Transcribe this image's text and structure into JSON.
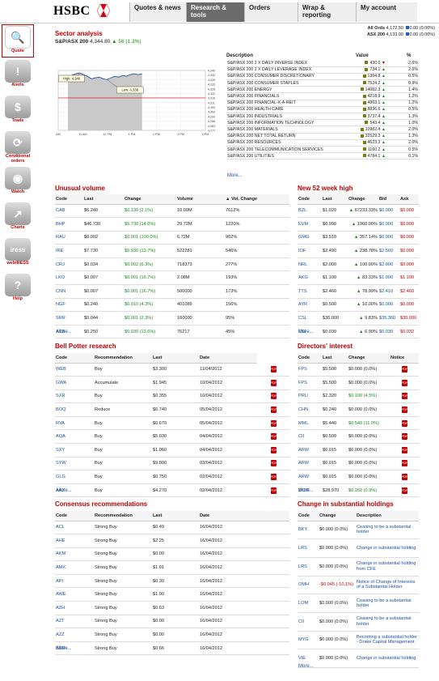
{
  "brand": {
    "logo_text": "HSBC"
  },
  "nav": [
    "Quotes & news",
    "Research & tools",
    "Orders",
    "Wrap & reporting",
    "My account"
  ],
  "indices": [
    {
      "name": "All Ords",
      "value": "4,172.50",
      "change": "0.00 (0.00%)"
    },
    {
      "name": "ASX 200",
      "value": "4,133.00",
      "change": "0.00 (0.00%)"
    }
  ],
  "sidebar": [
    {
      "label": "Quote",
      "icon": "magnifier-icon",
      "glyph": "🔍"
    },
    {
      "label": "Alerts",
      "icon": "warning-icon",
      "glyph": "!"
    },
    {
      "label": "Trade",
      "icon": "dollar-icon",
      "glyph": "$"
    },
    {
      "label": "Conditional orders",
      "icon": "refresh-icon",
      "glyph": "⟳"
    },
    {
      "label": "Watch",
      "icon": "binoculars-icon",
      "glyph": "◉"
    },
    {
      "label": "Charts",
      "icon": "chart-icon",
      "glyph": "↗"
    },
    {
      "label": "webIRESS",
      "icon": "iress-icon",
      "glyph": "iress"
    },
    {
      "label": "Help",
      "icon": "help-icon",
      "glyph": "?"
    }
  ],
  "sector": {
    "title": "Sector analysis",
    "index_name": "S&P/ASX 200",
    "index_value": "4,344.80",
    "index_change": "56 (1.3%)",
    "desc_header": "Description",
    "value_header": "Value",
    "pct_header": "%",
    "rows": [
      {
        "d": "S&P/ASX 200 2 X DAILY INVERSE INDEX",
        "v": "430.0",
        "p": "-2.6%",
        "dir": "down"
      },
      {
        "d": "S&P/ASX 200 2 X DAILY LEVERAGE INDEX",
        "v": "734.1",
        "p": "2.6%",
        "dir": "up"
      },
      {
        "d": "S&P/ASX 200 CONSUMER DISCRETIONARY",
        "v": "1304.8",
        "p": "0.5%",
        "dir": "up"
      },
      {
        "d": "S&P/ASX 200 CONSUMER STAPLES",
        "v": "7524.2",
        "p": "0.9%",
        "dir": "up"
      },
      {
        "d": "S&P/ASX 200 ENERGY",
        "v": "14082.3",
        "p": "1.4%",
        "dir": "up"
      },
      {
        "d": "S&P/ASX 200 FINANCIALS",
        "v": "4218.9",
        "p": "1.2%",
        "dir": "up"
      },
      {
        "d": "S&P/ASX 200 FINANCIAL-X-A-REIT",
        "v": "4863.1",
        "p": "1.2%",
        "dir": "up"
      },
      {
        "d": "S&P/ASX 200 HEALTH CARE",
        "v": "8836.6",
        "p": "0.5%",
        "dir": "up"
      },
      {
        "d": "S&P/ASX 200 INDUSTRIALS",
        "v": "3737.4",
        "p": "1.3%",
        "dir": "up"
      },
      {
        "d": "S&P/ASX 200 INFORMATION TECHNOLOGY",
        "v": "543.4",
        "p": "1.0%",
        "dir": "up"
      },
      {
        "d": "S&P/ASX 200 MATERIALS",
        "v": "10982.4",
        "p": "2.0%",
        "dir": "up"
      },
      {
        "d": "S&P/ASX 200 NET TOTAL RETURN",
        "v": "32529.3",
        "p": "1.3%",
        "dir": "up"
      },
      {
        "d": "S&P/ASX 200 RESOURCES",
        "v": "4623.3",
        "p": "2.0%",
        "dir": "up"
      },
      {
        "d": "S&P/ASX 200 TELECOMMUNICATION SERVICES",
        "v": "1160.2",
        "p": "0.5%",
        "dir": "up"
      },
      {
        "d": "S&P/ASX 200 UTILITIES",
        "v": "4784.1",
        "p": "0.1%",
        "dir": "up"
      }
    ],
    "more": "More..."
  },
  "chart_data": {
    "type": "area",
    "x": [
      "AM",
      "11 AM",
      "12 PM",
      "1 PM",
      "2 PM",
      "3 PM",
      "4 PM"
    ],
    "y_ticks": [
      "4,349",
      "4,344",
      "4,339",
      "4,333",
      "4,328",
      "4,322",
      "4,316",
      "4,311",
      "4,305",
      "4,300",
      "4,294",
      "4,288",
      "4,283",
      "4,277"
    ],
    "ylim": [
      4277,
      4349
    ],
    "prev_close": 4316,
    "high_label": "High: 4,346",
    "low_label": "Low: 4,338",
    "values": [
      4341,
      4343,
      4345,
      4346,
      4344,
      4342,
      4339,
      4340,
      4341,
      4339,
      4338,
      4340,
      4342,
      4341,
      4343,
      4342,
      4344,
      4345,
      4344,
      4345
    ]
  },
  "unusual": {
    "title": "Unusual volume",
    "headers": [
      "Code",
      "Last",
      "Change",
      "Volume",
      "▲ Vol. Change"
    ],
    "rows": [
      [
        "CAB",
        "$6.240",
        "$0.130 (2.1%)",
        "10.09M",
        "7612%"
      ],
      [
        "BHP",
        "$46.730",
        "$5.730 (14.0%)",
        "29.72M",
        "1220%"
      ],
      [
        "RAU",
        "$0.002",
        "$0.001 (100.0%)",
        "6.72M",
        "902%"
      ],
      [
        "IRE",
        "$7.730",
        "$0.930 (13.7%)",
        "522281",
        "546%"
      ],
      [
        "CRJ",
        "$0.034",
        "$0.002 (6.3%)",
        "718373",
        "277%"
      ],
      [
        "LKO",
        "$0.007",
        "$0.001 (16.7%)",
        "2.08M",
        "193%"
      ],
      [
        "CNN",
        "$0.007",
        "$0.001 (16.7%)",
        "500000",
        "173%"
      ],
      [
        "NGF",
        "$0.240",
        "$0.010 (4.3%)",
        "401089",
        "156%"
      ],
      [
        "SRR",
        "$0.044",
        "$0.001 (2.3%)",
        "160000",
        "95%"
      ],
      [
        "ACB",
        "$0.250",
        "$0.030 (13.6%)",
        "76217",
        "45%"
      ]
    ],
    "more": "More..."
  },
  "high52": {
    "title": "New 52 week high",
    "headers": [
      "Code",
      "Last",
      "Change",
      "Bid",
      "Ask"
    ],
    "rows": [
      [
        "BZL",
        "$1.020",
        "67233.33%",
        "$0.000",
        "$0.000"
      ],
      [
        "EVM",
        "$0.990",
        "1960.00%",
        "$0.000",
        "$0.000"
      ],
      [
        "GMG",
        "$3.510",
        "357.14%",
        "$0.000",
        "$0.000"
      ],
      [
        "IOF",
        "$2.490",
        "238.78%",
        "$2.560",
        "$0.000"
      ],
      [
        "NRL",
        "$2.000",
        "100.00%",
        "$2.000",
        "$0.000"
      ],
      [
        "AKG",
        "$1.100",
        "83.33%",
        "$1.000",
        "$1.100"
      ],
      [
        "TTS",
        "$2.460",
        "78.99%",
        "$2.410",
        "$2.460"
      ],
      [
        "AYR",
        "$0.500",
        "10.00%",
        "$0.000",
        "$0.000"
      ],
      [
        "CSL",
        "$36.000",
        "9.83%",
        "$35.360",
        "$36.000"
      ],
      [
        "ESI",
        "$0.030",
        "6.90%",
        "$0.030",
        "$0.032"
      ]
    ],
    "more": "More..."
  },
  "bellpotter": {
    "title": "Bell Potter research",
    "headers": [
      "Code",
      "Recommendation",
      "Last",
      "Date"
    ],
    "rows": [
      [
        "WEB",
        "Buy",
        "$3.300",
        "11/04/2012"
      ],
      [
        "GWA",
        "Accumulate",
        "$1.945",
        "10/04/2012"
      ],
      [
        "SXR",
        "Buy",
        "$0.355",
        "10/04/2012"
      ],
      [
        "BOQ",
        "Reduce",
        "$6.740",
        "05/04/2012"
      ],
      [
        "RVA",
        "Buy",
        "$0.670",
        "05/04/2012"
      ],
      [
        "AQA",
        "Buy",
        "$5.030",
        "04/04/2012"
      ],
      [
        "SXY",
        "Buy",
        "$1.060",
        "04/04/2012"
      ],
      [
        "SYW",
        "Buy",
        "$9.800",
        "03/04/2012"
      ],
      [
        "GLG",
        "Buy",
        "$0.750",
        "02/04/2012"
      ],
      [
        "AAX",
        "Buy",
        "$4.270",
        "02/04/2012"
      ]
    ],
    "more": "More..."
  },
  "directors": {
    "title": "Directors' interest",
    "headers": [
      "Code",
      "Last",
      "Change",
      "Notice"
    ],
    "rows": [
      [
        "FPS",
        "$5.500",
        "$0.000 (0.0%)"
      ],
      [
        "FPS",
        "$5.500",
        "$0.000 (0.0%)"
      ],
      [
        "PRU",
        "$2.320",
        "$0.100 (4.5%)"
      ],
      [
        "CHN",
        "$0.240",
        "$0.000 (0.0%)"
      ],
      [
        "MML",
        "$5.440",
        "$0.540 (11.0%)"
      ],
      [
        "CII",
        "$0.500",
        "$0.000 (0.0%)"
      ],
      [
        "ARW",
        "$0.015",
        "$0.000 (0.0%)"
      ],
      [
        "ARW",
        "$0.015",
        "$0.000 (0.0%)"
      ],
      [
        "ARW",
        "$0.015",
        "$0.000 (0.0%)"
      ],
      [
        "WOR",
        "$28.970",
        "$0.260 (0.9%)"
      ]
    ],
    "more": "More..."
  },
  "consensus": {
    "title": "Consensus recommendations",
    "headers": [
      "Code",
      "Recommendation",
      "Last",
      "Date"
    ],
    "rows": [
      [
        "ACL",
        "Strong Buy",
        "$0.49",
        "16/04/2012"
      ],
      [
        "AHE",
        "Strong Buy",
        "$2.25",
        "16/04/2012"
      ],
      [
        "AKM",
        "Strong Buy",
        "$0.00",
        "16/04/2012"
      ],
      [
        "AMX",
        "Strong Buy",
        "$1.01",
        "16/04/2012"
      ],
      [
        "API",
        "Strong Buy",
        "$0.30",
        "16/04/2012"
      ],
      [
        "AWE",
        "Strong Buy",
        "$1.90",
        "16/04/2012"
      ],
      [
        "AZH",
        "Strong Buy",
        "$0.63",
        "16/04/2012"
      ],
      [
        "AZT",
        "Strong Buy",
        "$0.00",
        "16/04/2012"
      ],
      [
        "AZZ",
        "Strong Buy",
        "$0.00",
        "16/04/2012"
      ],
      [
        "BDR",
        "Strong Buy",
        "$0.66",
        "16/04/2012"
      ]
    ],
    "more": "More..."
  },
  "holdings": {
    "title": "Change in substantial holdings",
    "headers": [
      "Code",
      "Change",
      "Description"
    ],
    "rows": [
      [
        "BKY",
        "$0.000 (0.0%)",
        "Ceasing to be a substantial holder"
      ],
      [
        "LRS",
        "$0.000 (0.0%)",
        "Change in substantial holding"
      ],
      [
        "LRS",
        "$0.000 (0.0%)",
        "Change in substantial holding from CFE"
      ],
      [
        "OMH",
        "-$0.045 (-10.1%)",
        "Notice of Change of Interests of a Substantial Holder"
      ],
      [
        "LOM",
        "$0.000 (0.0%)",
        "Ceasing to be a substantial holder"
      ],
      [
        "CII",
        "$0.000 (0.0%)",
        "Ceasing to be a substantial holder"
      ],
      [
        "MYG",
        "$0.000 (0.0%)",
        "Becoming a substantial holder - Drake Capital Management"
      ],
      [
        "VIE",
        "$0.000 (0.0%)",
        "Change in substantial holding"
      ]
    ],
    "more": "More..."
  },
  "colors": {
    "accent": "#c00000",
    "link": "#1a4fa0",
    "up": "#1a8a1a",
    "down": "#c00000"
  }
}
